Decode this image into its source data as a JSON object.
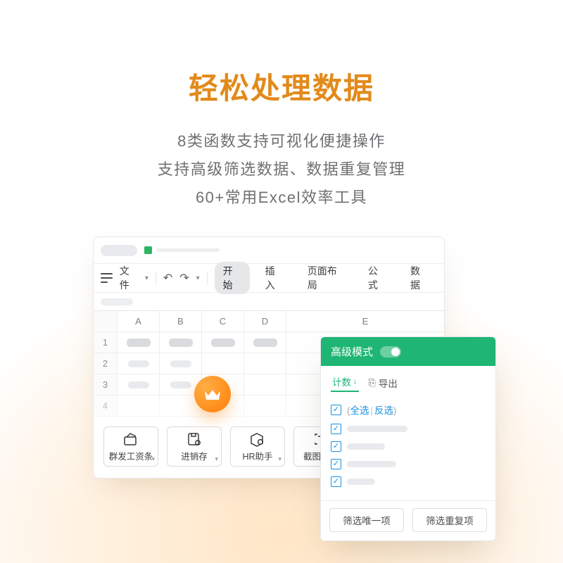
{
  "hero": {
    "title": "轻松处理数据",
    "line1": "8类函数支持可视化便捷操作",
    "line2": "支持高级筛选数据、数据重复管理",
    "line3": "60+常用Excel效率工具"
  },
  "window": {
    "file_menu": "文件",
    "tabs": {
      "start": "开始",
      "insert": "插入",
      "layout": "页面布局",
      "formula": "公式",
      "data": "数据"
    },
    "columns": [
      "A",
      "B",
      "C",
      "D",
      "E"
    ],
    "rows": [
      "1",
      "2",
      "3",
      "4"
    ],
    "tools": {
      "payroll": "群发工资条",
      "inventory": "进销存",
      "hr": "HR助手",
      "ocr": "截图取字"
    }
  },
  "panel": {
    "header": "高级模式",
    "count": "计数",
    "export": "导出",
    "select_all": "全选",
    "invert": "反选",
    "footer_unique": "筛选唯一项",
    "footer_dup": "筛选重复项"
  }
}
